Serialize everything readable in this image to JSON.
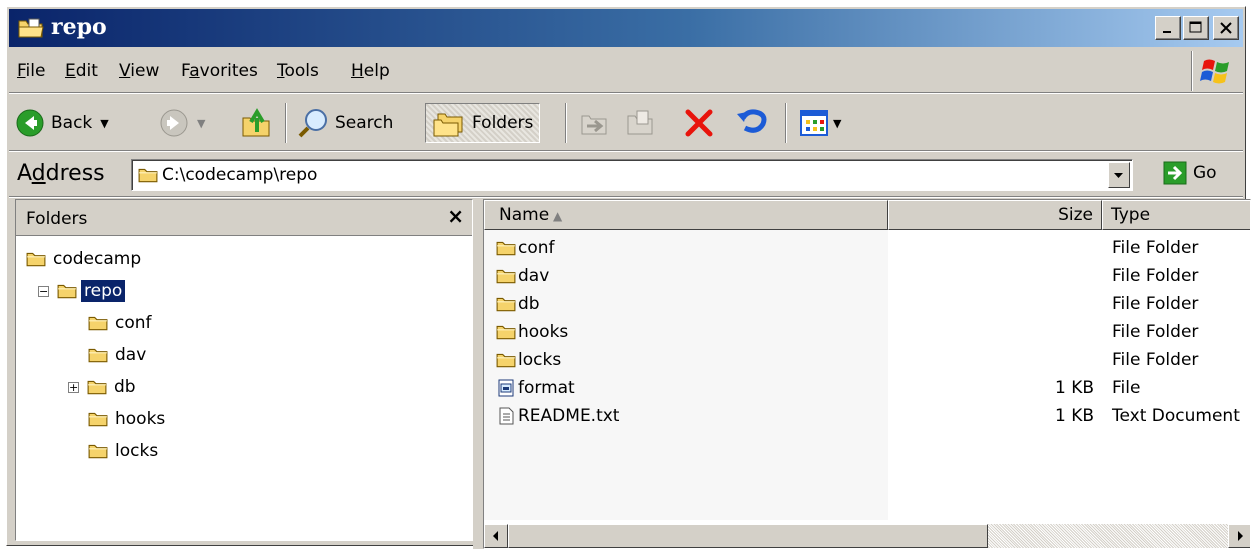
{
  "window": {
    "title": "repo",
    "icon": "explorer-folder-icon",
    "title_gradient": [
      "#0a246a",
      "#a6caf0"
    ],
    "caption_buttons": [
      "minimize",
      "maximize",
      "close"
    ]
  },
  "menu": {
    "items": [
      {
        "pre": "",
        "accel": "F",
        "post": "ile"
      },
      {
        "pre": "",
        "accel": "E",
        "post": "dit"
      },
      {
        "pre": "",
        "accel": "V",
        "post": "iew"
      },
      {
        "pre": "F",
        "accel": "a",
        "post": "vorites"
      },
      {
        "pre": "",
        "accel": "T",
        "post": "ools"
      },
      {
        "pre": "",
        "accel": "H",
        "post": "elp"
      }
    ]
  },
  "toolbar": {
    "back_label": "Back",
    "search_label": "Search",
    "folders_label": "Folders",
    "folders_pressed": true,
    "icons": [
      "back-icon",
      "forward-icon",
      "up-folder-icon",
      "search-icon",
      "folders-icon",
      "move-to-icon",
      "copy-to-icon",
      "delete-icon",
      "undo-icon",
      "views-icon"
    ]
  },
  "address": {
    "label_pre": "A",
    "label_accel": "d",
    "label_post": "dress",
    "value": "C:\\codecamp\\repo",
    "go_label": "Go"
  },
  "folders_pane": {
    "title": "Folders",
    "tree": [
      {
        "label": "codecamp",
        "depth": 0,
        "expander": "",
        "selected": false
      },
      {
        "label": "repo",
        "depth": 1,
        "expander": "−",
        "selected": true
      },
      {
        "label": "conf",
        "depth": 2,
        "expander": "",
        "selected": false
      },
      {
        "label": "dav",
        "depth": 2,
        "expander": "",
        "selected": false
      },
      {
        "label": "db",
        "depth": 2,
        "expander": "+",
        "selected": false
      },
      {
        "label": "hooks",
        "depth": 2,
        "expander": "",
        "selected": false
      },
      {
        "label": "locks",
        "depth": 2,
        "expander": "",
        "selected": false
      }
    ]
  },
  "file_list": {
    "columns": {
      "name": "Name",
      "size": "Size",
      "type": "Type"
    },
    "sort_column": "name",
    "sort_direction": "ascending",
    "rows": [
      {
        "name": "conf",
        "size": "",
        "type": "File Folder",
        "icon": "folder-icon"
      },
      {
        "name": "dav",
        "size": "",
        "type": "File Folder",
        "icon": "folder-icon"
      },
      {
        "name": "db",
        "size": "",
        "type": "File Folder",
        "icon": "folder-icon"
      },
      {
        "name": "hooks",
        "size": "",
        "type": "File Folder",
        "icon": "folder-icon"
      },
      {
        "name": "locks",
        "size": "",
        "type": "File Folder",
        "icon": "folder-icon"
      },
      {
        "name": "format",
        "size": "1 KB",
        "type": "File",
        "icon": "generic-file-icon"
      },
      {
        "name": "README.txt",
        "size": "1 KB",
        "type": "Text Document",
        "icon": "text-document-icon"
      }
    ]
  },
  "colors": {
    "chrome": "#d4d0c8",
    "selection": "#0a246a",
    "folder_yellow": "#f5d36b",
    "delete_red": "#e8140c",
    "go_green": "#2a9d2a"
  }
}
